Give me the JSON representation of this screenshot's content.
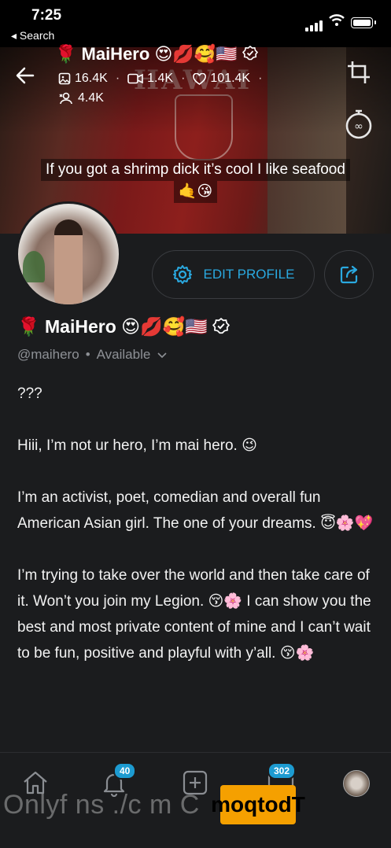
{
  "status_bar": {
    "time": "7:25",
    "back_app": "◂ Search"
  },
  "cover": {
    "name": "🌹 MaiHero 😍💋🥰🇺🇸",
    "stats": {
      "photos": "16.4K",
      "videos": "1.4K",
      "likes": "101.4K",
      "subscribers": "4.4K"
    },
    "caption": "If you got a shrimp dick it’s cool I like seafood",
    "caption_emoji": "🤙😘"
  },
  "buttons": {
    "edit_profile": "EDIT PROFILE"
  },
  "profile": {
    "name": "🌹 MaiHero 😍💋🥰🇺🇸",
    "handle": "@maihero",
    "separator": "•",
    "availability": "Available",
    "bio": [
      "???",
      "Hiii, I’m not ur hero, I’m mai hero. 😉",
      "I’m an activist, poet, comedian and overall fun American Asian girl. The one of your dreams. 😇🌸💖",
      "I’m trying to take over the world and then take care of it. Won’t you join my Legion. 😚🌸 I can show you the best and most private content of mine and I can’t wait to be fun, positive and playful with y’all. 😚🌸"
    ]
  },
  "nav": {
    "notifications_badge": "40",
    "messages_badge": "302"
  },
  "watermark": {
    "text": "Onlyf ns ./c m C",
    "brand": "moqtodT"
  },
  "colors": {
    "accent": "#2aa9e0",
    "background": "#1b1c1e",
    "badge": "#1d9bd1"
  }
}
